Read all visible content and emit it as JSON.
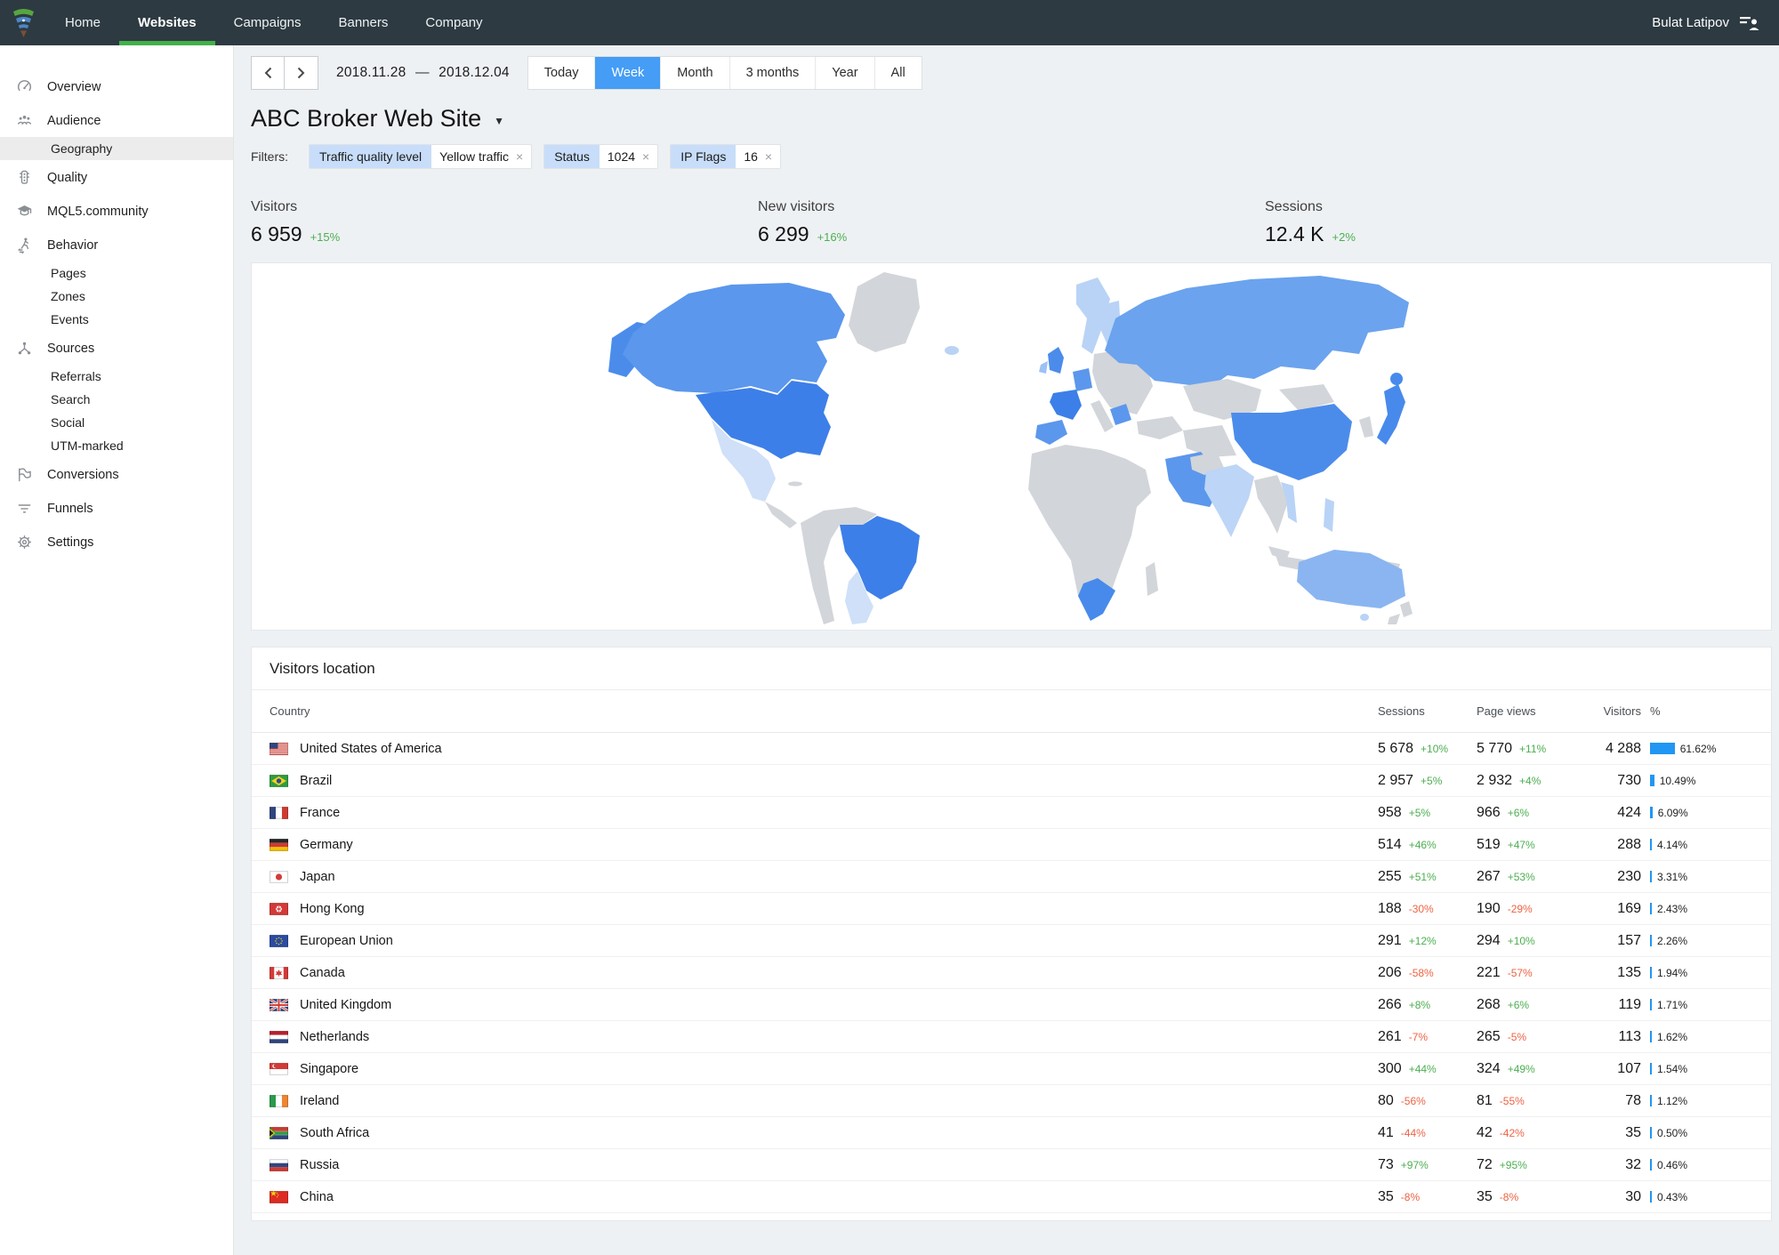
{
  "colors": {
    "header_bg": "#2d3a42",
    "active_tab_underline": "#43b049",
    "range_active_bg": "#459df5",
    "chip_key_bg": "#c8ddf9",
    "accent_blue": "#2196f3",
    "positive_green": "#4caf50",
    "negative_red": "#ef6243",
    "page_bg": "#eef1f4"
  },
  "header": {
    "nav": [
      {
        "label": "Home",
        "active": false
      },
      {
        "label": "Websites",
        "active": true
      },
      {
        "label": "Campaigns",
        "active": false
      },
      {
        "label": "Banners",
        "active": false
      },
      {
        "label": "Company",
        "active": false
      }
    ],
    "user": "Bulat Latipov"
  },
  "sidebar": {
    "items": [
      {
        "label": "Overview",
        "icon": "gauge"
      },
      {
        "label": "Audience",
        "icon": "people",
        "children": [
          {
            "label": "Geography",
            "active": true
          }
        ]
      },
      {
        "label": "Quality",
        "icon": "traffic-light"
      },
      {
        "label": "MQL5.community",
        "icon": "graduation-cap"
      },
      {
        "label": "Behavior",
        "icon": "walking-person",
        "children": [
          {
            "label": "Pages"
          },
          {
            "label": "Zones"
          },
          {
            "label": "Events"
          }
        ]
      },
      {
        "label": "Sources",
        "icon": "share-network",
        "children": [
          {
            "label": "Referrals"
          },
          {
            "label": "Search"
          },
          {
            "label": "Social"
          },
          {
            "label": "UTM-marked"
          }
        ]
      },
      {
        "label": "Conversions",
        "icon": "flag"
      },
      {
        "label": "Funnels",
        "icon": "funnel"
      },
      {
        "label": "Settings",
        "icon": "gear"
      }
    ]
  },
  "toolbar": {
    "date_from": "2018.11.28",
    "date_dash": "—",
    "date_to": "2018.12.04",
    "ranges": [
      "Today",
      "Week",
      "Month",
      "3 months",
      "Year",
      "All"
    ],
    "active_range": "Week"
  },
  "page": {
    "title": "ABC Broker Web Site"
  },
  "filters": {
    "label": "Filters:",
    "chips": [
      {
        "name": "Traffic quality level",
        "value": "Yellow traffic",
        "removable": true
      },
      {
        "name": "Status",
        "value": "1024",
        "removable": true
      },
      {
        "name": "IP Flags",
        "value": "16",
        "removable": true
      }
    ]
  },
  "stats": [
    {
      "label": "Visitors",
      "value": "6 959",
      "change": "+15%"
    },
    {
      "label": "New visitors",
      "value": "6 299",
      "change": "+16%"
    },
    {
      "label": "Sessions",
      "value": "12.4 K",
      "change": "+2%"
    }
  ],
  "map": {
    "fills": {
      "default": "#d2d5d9",
      "alaska": "#4b8ceb",
      "canada": "#5b97ec",
      "usa": "#3d7fe8",
      "mexico": "#cfe0f8",
      "central_america": "#d2d5d9",
      "greenland": "#d2d5d9",
      "iceland": "#b9d3f6",
      "andes": "#d2d5d9",
      "brazil": "#3d7fe8",
      "argentina": "#cfe0f8",
      "uk": "#4b8ceb",
      "ireland": "#9cc1f4",
      "scandinavia": "#b9d3f6",
      "baltic": "#b9d3f6",
      "germany": "#5b97ec",
      "france": "#3d7fe8",
      "iberia": "#5b97ec",
      "italy": "#d2d5d9",
      "east_europe": "#d2d5d9",
      "balkans": "#5b97ec",
      "turkey": "#d2d5d9",
      "africa": "#d2d5d9",
      "south_africa": "#478aeb",
      "madagascar": "#d2d5d9",
      "russia": "#6ba3ee",
      "central_asia": "#d2d5d9",
      "mongolia": "#d2d5d9",
      "saudi": "#5b97ec",
      "iran": "#d2d5d9",
      "pakistan": "#d2d5d9",
      "china": "#4b8ceb",
      "india": "#bdd5f6",
      "se_asia": "#d2d5d9",
      "vietnam": "#b9d3f6",
      "philippines": "#b9d3f6",
      "malaysia": "#d2d5d9",
      "indonesia": "#d2d5d9",
      "new_guinea": "#d2d5d9",
      "japan": "#478aeb",
      "korea": "#d2d5d9",
      "australia": "#8ab5f1",
      "tasmania": "#b9d3f6",
      "new_zealand": "#d2d5d9",
      "cuba": "#d2d5d9"
    }
  },
  "table": {
    "title": "Visitors location",
    "columns": [
      "Country",
      "Sessions",
      "Page views",
      "Visitors",
      "%"
    ],
    "rows": [
      {
        "country": "United States of America",
        "flag": "us",
        "sessions": "5 678",
        "sessions_change": "+10%",
        "pageviews": "5 770",
        "pageviews_change": "+11%",
        "visitors": "4 288",
        "percent": "61.62%"
      },
      {
        "country": "Brazil",
        "flag": "br",
        "sessions": "2 957",
        "sessions_change": "+5%",
        "pageviews": "2 932",
        "pageviews_change": "+4%",
        "visitors": "730",
        "percent": "10.49%"
      },
      {
        "country": "France",
        "flag": "fr",
        "sessions": "958",
        "sessions_change": "+5%",
        "pageviews": "966",
        "pageviews_change": "+6%",
        "visitors": "424",
        "percent": "6.09%"
      },
      {
        "country": "Germany",
        "flag": "de",
        "sessions": "514",
        "sessions_change": "+46%",
        "pageviews": "519",
        "pageviews_change": "+47%",
        "visitors": "288",
        "percent": "4.14%"
      },
      {
        "country": "Japan",
        "flag": "jp",
        "sessions": "255",
        "sessions_change": "+51%",
        "pageviews": "267",
        "pageviews_change": "+53%",
        "visitors": "230",
        "percent": "3.31%"
      },
      {
        "country": "Hong Kong",
        "flag": "hk",
        "sessions": "188",
        "sessions_change": "-30%",
        "pageviews": "190",
        "pageviews_change": "-29%",
        "visitors": "169",
        "percent": "2.43%"
      },
      {
        "country": "European Union",
        "flag": "eu",
        "sessions": "291",
        "sessions_change": "+12%",
        "pageviews": "294",
        "pageviews_change": "+10%",
        "visitors": "157",
        "percent": "2.26%"
      },
      {
        "country": "Canada",
        "flag": "ca",
        "sessions": "206",
        "sessions_change": "-58%",
        "pageviews": "221",
        "pageviews_change": "-57%",
        "visitors": "135",
        "percent": "1.94%"
      },
      {
        "country": "United Kingdom",
        "flag": "gb",
        "sessions": "266",
        "sessions_change": "+8%",
        "pageviews": "268",
        "pageviews_change": "+6%",
        "visitors": "119",
        "percent": "1.71%"
      },
      {
        "country": "Netherlands",
        "flag": "nl",
        "sessions": "261",
        "sessions_change": "-7%",
        "pageviews": "265",
        "pageviews_change": "-5%",
        "visitors": "113",
        "percent": "1.62%"
      },
      {
        "country": "Singapore",
        "flag": "sg",
        "sessions": "300",
        "sessions_change": "+44%",
        "pageviews": "324",
        "pageviews_change": "+49%",
        "visitors": "107",
        "percent": "1.54%"
      },
      {
        "country": "Ireland",
        "flag": "ie",
        "sessions": "80",
        "sessions_change": "-56%",
        "pageviews": "81",
        "pageviews_change": "-55%",
        "visitors": "78",
        "percent": "1.12%"
      },
      {
        "country": "South Africa",
        "flag": "za",
        "sessions": "41",
        "sessions_change": "-44%",
        "pageviews": "42",
        "pageviews_change": "-42%",
        "visitors": "35",
        "percent": "0.50%"
      },
      {
        "country": "Russia",
        "flag": "ru",
        "sessions": "73",
        "sessions_change": "+97%",
        "pageviews": "72",
        "pageviews_change": "+95%",
        "visitors": "32",
        "percent": "0.46%"
      },
      {
        "country": "China",
        "flag": "cn",
        "sessions": "35",
        "sessions_change": "-8%",
        "pageviews": "35",
        "pageviews_change": "-8%",
        "visitors": "30",
        "percent": "0.43%"
      }
    ]
  }
}
